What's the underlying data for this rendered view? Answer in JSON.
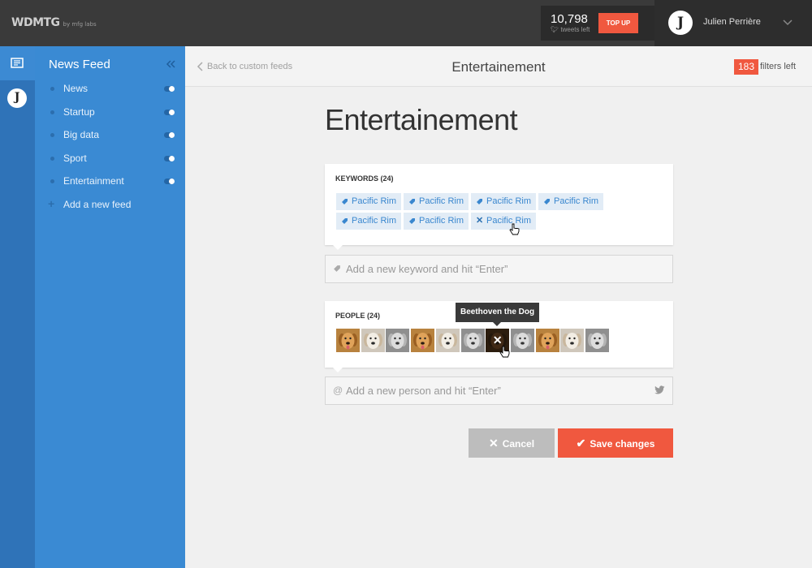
{
  "app": {
    "logo": "WDMTG",
    "logo_sub": "by mfg labs"
  },
  "topbar": {
    "tweets_count": "10,798",
    "tweets_label": "tweets left",
    "topup_label": "TOP UP",
    "user_name": "Julien Perrière"
  },
  "sidebar": {
    "title": "News Feed",
    "feeds": [
      {
        "label": "News"
      },
      {
        "label": "Startup"
      },
      {
        "label": "Big data"
      },
      {
        "label": "Sport"
      },
      {
        "label": "Entertainment"
      }
    ],
    "add_feed_label": "Add a new feed"
  },
  "header": {
    "back_label": "Back to custom feeds",
    "title": "Entertainement",
    "filters_count": "183",
    "filters_label": "filters left"
  },
  "page": {
    "title": "Entertainement"
  },
  "keywords": {
    "label": "KEYWORDS (24)",
    "tags": [
      {
        "label": "Pacific Rim",
        "state": "normal"
      },
      {
        "label": "Pacific Rim",
        "state": "normal"
      },
      {
        "label": "Pacific Rim",
        "state": "normal"
      },
      {
        "label": "Pacific Rim",
        "state": "normal"
      },
      {
        "label": "Pacific Rim",
        "state": "normal"
      },
      {
        "label": "Pacific Rim",
        "state": "normal"
      },
      {
        "label": "Pacific Rim",
        "state": "remove-hover"
      }
    ],
    "input_placeholder": "Add a new keyword and hit “Enter”"
  },
  "people": {
    "label": "PEOPLE (24)",
    "tooltip": "Beethoven the Dog",
    "thumbs": [
      "golden",
      "white",
      "grey",
      "golden",
      "white",
      "grey",
      "brown",
      "grey",
      "golden",
      "white",
      "grey"
    ],
    "hover_index": 6,
    "input_placeholder": "Add a new person and hit “Enter”"
  },
  "actions": {
    "cancel_label": "Cancel",
    "save_label": "Save changes"
  },
  "colors": {
    "accent": "#f0583f",
    "sidebar": "#3a8ad3",
    "iconbar": "#2f73b8",
    "topbar": "#3a3a3a",
    "tag_bg": "#e2ecf6",
    "tag_text": "#3a87cf"
  }
}
